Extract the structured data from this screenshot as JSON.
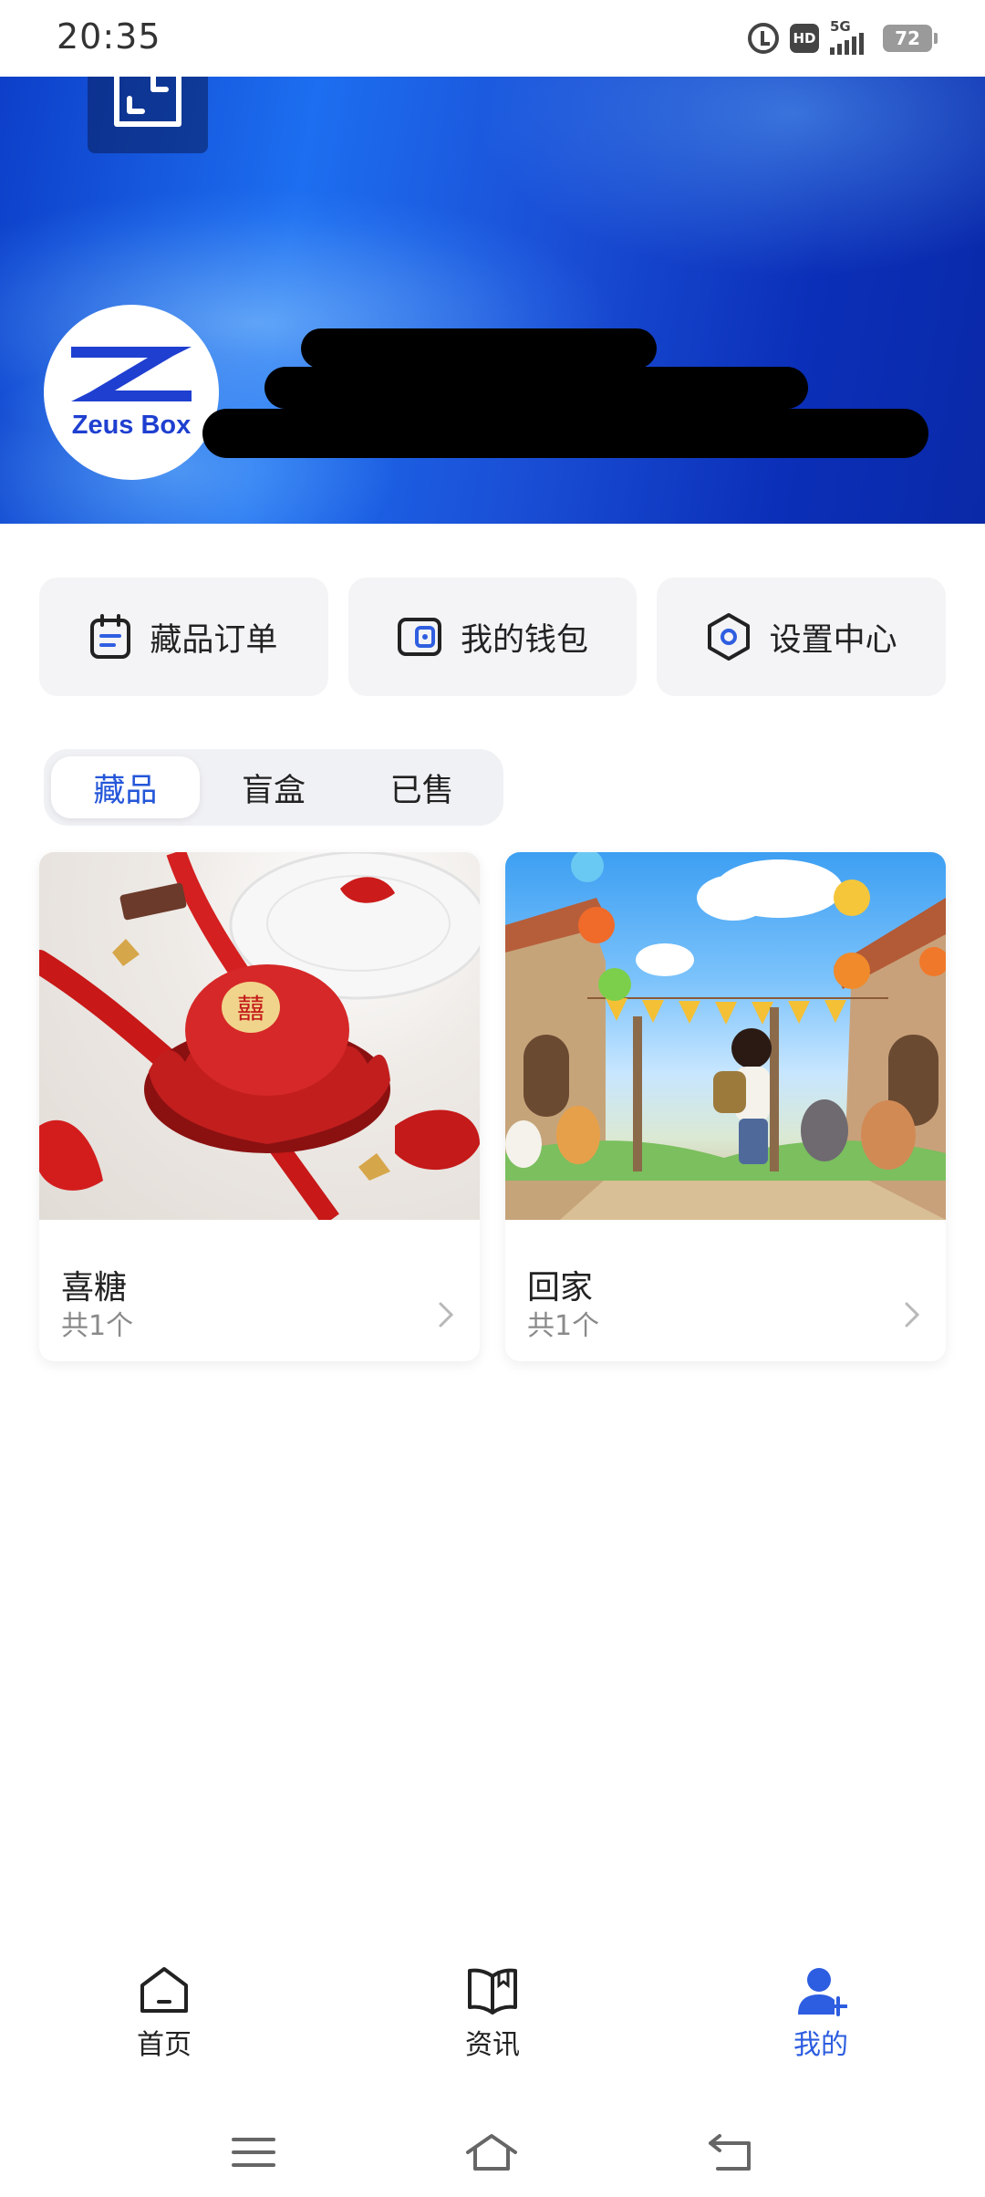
{
  "status_bar": {
    "time": "20:35",
    "network": "5G",
    "hd": "HD",
    "battery": "72"
  },
  "profile": {
    "avatar_brand": "Zeus Box"
  },
  "quick_actions": [
    {
      "label": "藏品订单",
      "icon": "calendar-list-icon"
    },
    {
      "label": "我的钱包",
      "icon": "wallet-icon"
    },
    {
      "label": "设置中心",
      "icon": "settings-hexagon-icon"
    }
  ],
  "tabs": [
    {
      "label": "藏品",
      "active": true
    },
    {
      "label": "盲盒",
      "active": false
    },
    {
      "label": "已售",
      "active": false
    }
  ],
  "collections": [
    {
      "title": "喜糖",
      "count": "共1个"
    },
    {
      "title": "回家",
      "count": "共1个"
    }
  ],
  "bottom_nav": [
    {
      "label": "首页",
      "icon": "home-icon",
      "active": false
    },
    {
      "label": "资讯",
      "icon": "book-icon",
      "active": false
    },
    {
      "label": "我的",
      "icon": "user-add-icon",
      "active": true
    }
  ],
  "colors": {
    "accent": "#2d5de0",
    "hero": "#1a4fd6"
  }
}
